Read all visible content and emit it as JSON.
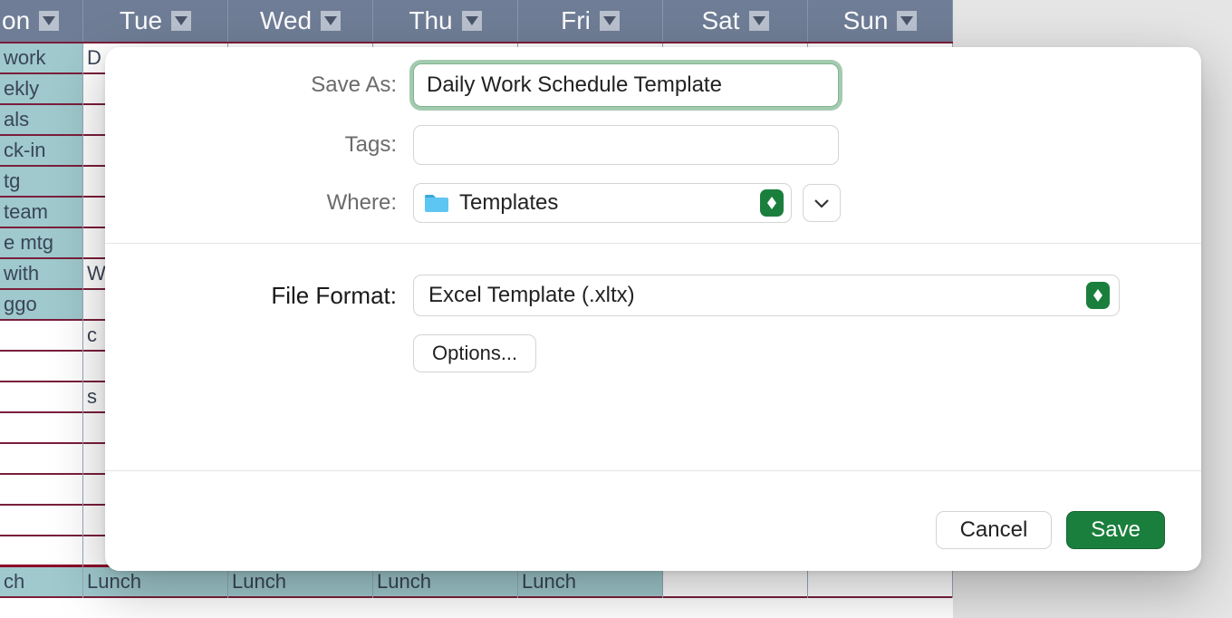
{
  "calendar": {
    "days": [
      "on",
      "Tue",
      "Wed",
      "Thu",
      "Fri",
      "Sat",
      "Sun"
    ],
    "rows_col0": [
      "work",
      "ekly",
      "als",
      "ck-in",
      "tg",
      "team",
      "e mtg",
      "with",
      "ggo",
      "",
      "",
      "",
      "",
      "",
      "",
      "",
      "",
      "ch"
    ],
    "rows_col1": [
      "D",
      "",
      "",
      "",
      "",
      "",
      "",
      "W",
      "",
      "c",
      "",
      "s",
      "",
      "",
      "",
      "",
      "",
      "Lunch"
    ],
    "rows_col2": [
      "",
      "",
      "",
      "",
      "",
      "",
      "",
      "",
      "",
      "",
      "",
      "",
      "",
      "",
      "",
      "",
      "",
      "Lunch"
    ],
    "rows_col3": [
      "",
      "",
      "",
      "",
      "",
      "",
      "",
      "",
      "",
      "",
      "",
      "",
      "",
      "",
      "",
      "",
      "",
      "Lunch"
    ],
    "rows_col4": [
      "",
      "",
      "",
      "",
      "",
      "",
      "",
      "",
      "",
      "",
      "",
      "",
      "",
      "",
      "",
      "",
      "",
      "Lunch"
    ],
    "rows_col5": [
      "",
      "",
      "",
      "",
      "",
      "",
      "",
      "",
      "",
      "",
      "",
      "",
      "",
      "",
      "",
      "",
      "",
      ""
    ],
    "rows_col6": [
      "",
      "",
      "",
      "",
      "",
      "",
      "",
      "",
      "",
      "",
      "",
      "",
      "",
      "",
      "",
      "",
      "",
      ""
    ]
  },
  "dialog": {
    "save_as_label": "Save As:",
    "save_as_value": "Daily Work Schedule Template",
    "tags_label": "Tags:",
    "tags_value": "",
    "where_label": "Where:",
    "where_value": "Templates",
    "file_format_label": "File Format:",
    "file_format_value": "Excel Template (.xltx)",
    "options_label": "Options...",
    "cancel_label": "Cancel",
    "save_label": "Save"
  }
}
